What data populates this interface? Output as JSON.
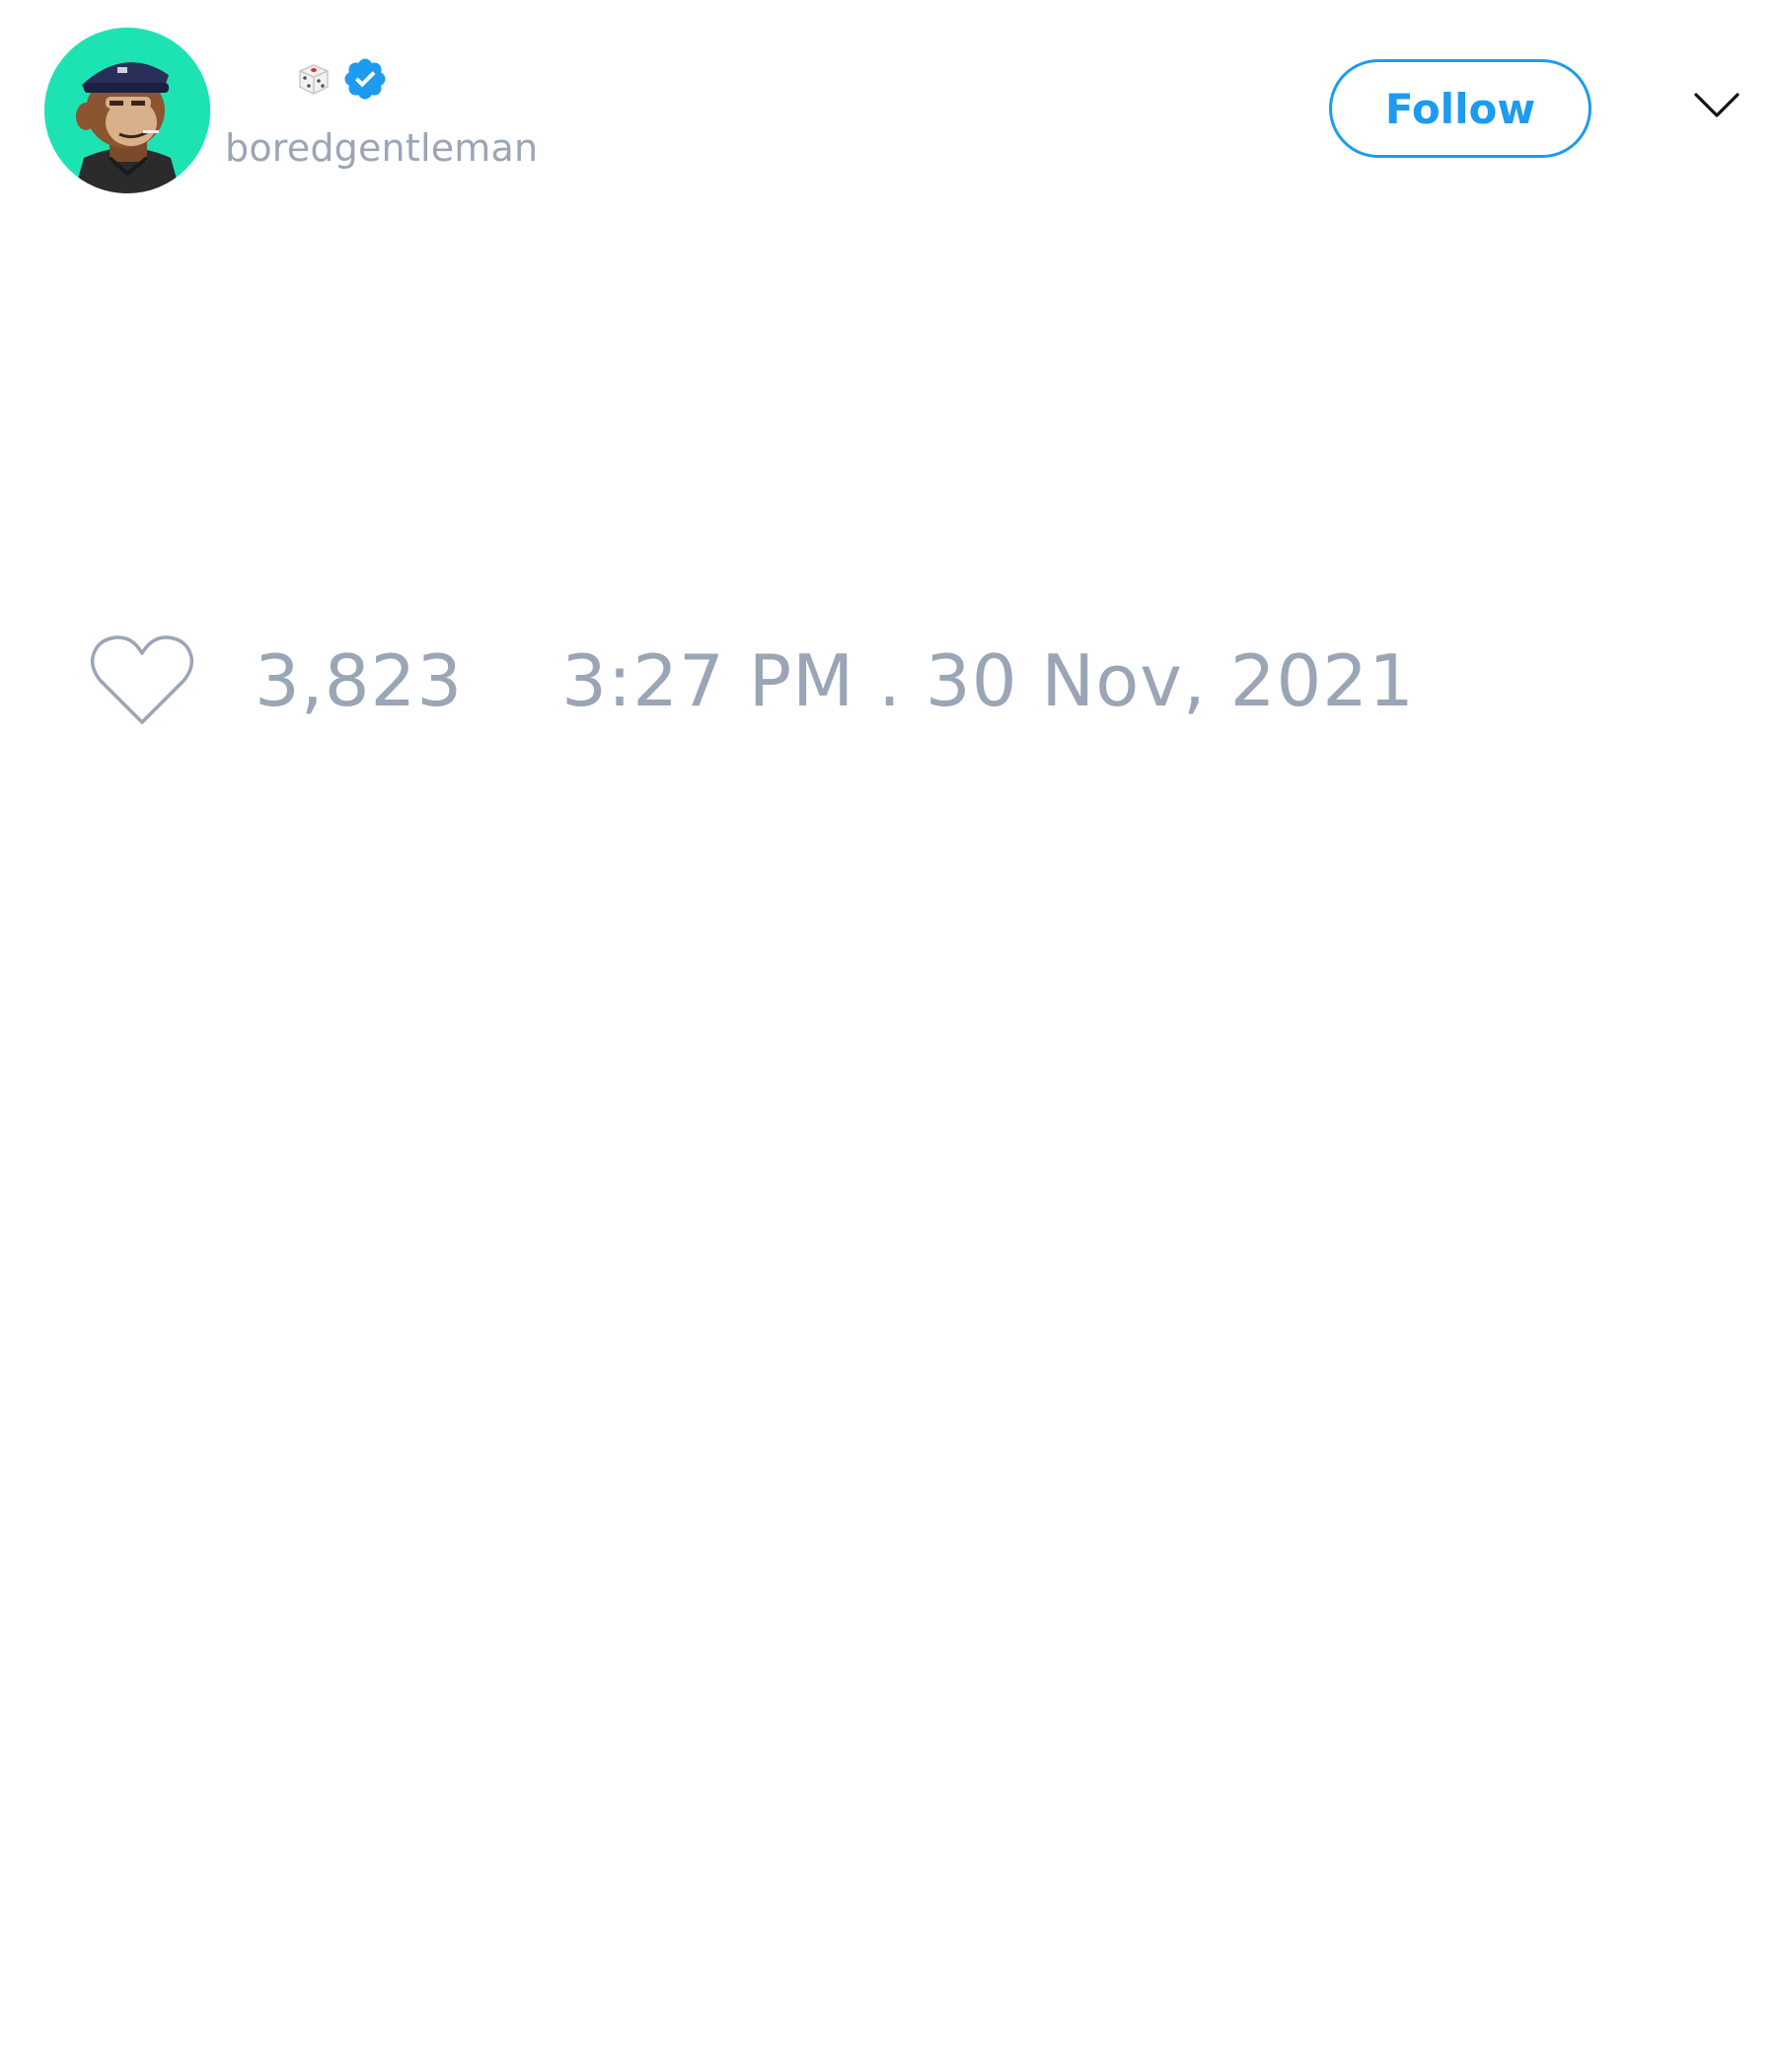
{
  "tweet": {
    "author": {
      "avatar_icon": "bored-ape-avatar",
      "avatar_bg": "#1de3b3",
      "name_icons": [
        "dice-icon",
        "verified-badge-icon"
      ],
      "handle": "boredgentleman"
    },
    "follow_label": "Follow",
    "menu_icon": "chevron-down-icon",
    "likes": {
      "icon": "heart-outline-icon",
      "count": "3,823"
    },
    "timestamp": "3:27 PM . 30 Nov, 2021"
  },
  "colors": {
    "accent": "#1d9bf0",
    "muted_text": "#9aa5b6",
    "background": "#ffffff"
  }
}
